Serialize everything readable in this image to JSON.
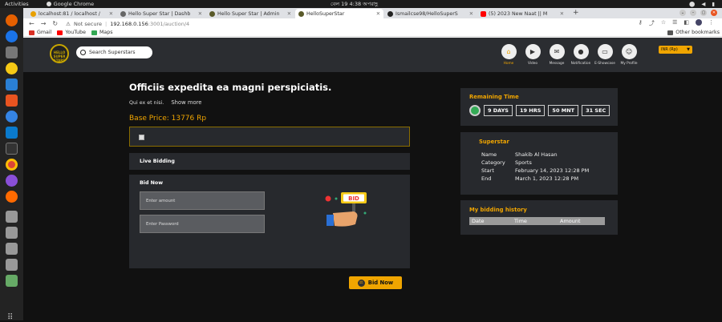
{
  "os": {
    "activities": "Activities",
    "app_name": "Google Chrome",
    "clock": "বেল 19  4:38 অপরাহ্ণ"
  },
  "browser": {
    "tabs": [
      {
        "label": "localhost:81 / localhost /",
        "favicon_color": "#e8a000",
        "active": false
      },
      {
        "label": "Hello Super Star | Dashb",
        "favicon_color": "#666666",
        "active": false
      },
      {
        "label": "Hello Super Star | Admin",
        "favicon_color": "#5a5a2a",
        "active": false
      },
      {
        "label": "HelloSuperStar",
        "favicon_color": "#5a5a2a",
        "active": true
      },
      {
        "label": "Ismailcse98/HelloSuperS",
        "favicon_color": "#222222",
        "active": false
      },
      {
        "label": "(5) 2023 New Naat || M",
        "favicon_color": "#ff0000",
        "active": false
      }
    ],
    "address": {
      "security": "Not secure",
      "host": "192.168.0.156",
      "path": ":3001/auction/4"
    },
    "bookmarks": [
      {
        "label": "Gmail",
        "color": "#d93025"
      },
      {
        "label": "YouTube",
        "color": "#ff0000"
      },
      {
        "label": "Maps",
        "color": "#34a853"
      }
    ],
    "other_bookmarks": "Other bookmarks"
  },
  "site": {
    "logo_text": "HELLO SUPER STARS",
    "search_placeholder": "Search Superstars",
    "nav": [
      {
        "label": "Home",
        "icon": "home-icon",
        "glyph": "⌂",
        "active": true
      },
      {
        "label": "Video",
        "icon": "video-icon",
        "glyph": "▶",
        "active": false
      },
      {
        "label": "Message",
        "icon": "message-icon",
        "glyph": "✉",
        "active": false
      },
      {
        "label": "Notification",
        "icon": "bell-icon",
        "glyph": "●",
        "active": false
      },
      {
        "label": "E-Showcase",
        "icon": "showcase-icon",
        "glyph": "▭",
        "active": false
      },
      {
        "label": "My Profile",
        "icon": "profile-icon",
        "glyph": "☺",
        "active": false
      }
    ],
    "currency": "INR (Rp)"
  },
  "auction": {
    "title": "Officiis expedita ea magni perspiciatis.",
    "subtitle": "Qui ex et nisi.",
    "show_more": "Show more",
    "base_price": "Base Price: 13776 Rp",
    "live_bidding": "Live Bidding",
    "bid_now_heading": "Bid Now",
    "amount_placeholder": "Enter amount",
    "password_placeholder": "Enter Password",
    "bid_button": "Bid Now",
    "illustration_text": "BID"
  },
  "remaining": {
    "title": "Remaining Time",
    "days": "9 DAYS",
    "hrs": "19 HRS",
    "mnt": "50 MNT",
    "sec": "31 SEC"
  },
  "superstar": {
    "title": "Superstar",
    "rows": [
      {
        "key": "Name",
        "value": "Shakib Al Hasan"
      },
      {
        "key": "Category",
        "value": "Sports"
      },
      {
        "key": "Start",
        "value": "February 14, 2023 12:28 PM"
      },
      {
        "key": "End",
        "value": "March 1, 2023 12:28 PM"
      }
    ]
  },
  "history": {
    "title": "My bidding history",
    "columns": [
      "Date",
      "Time",
      "Amount"
    ]
  },
  "colors": {
    "accent": "#f0a500",
    "panel": "#27292d",
    "header": "#2b2d31"
  }
}
